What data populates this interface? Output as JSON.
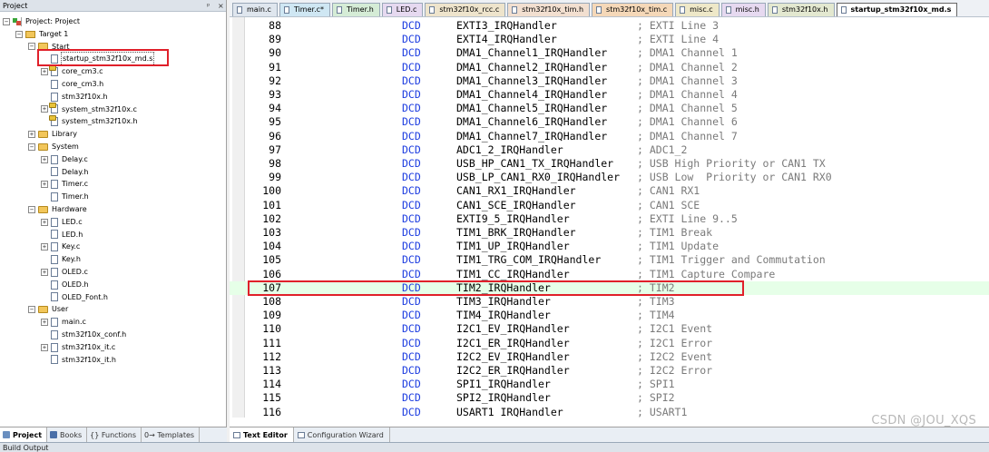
{
  "project_pane": {
    "title": "Project",
    "pin_glyph": "ᵖ",
    "close_glyph": "×",
    "tree": [
      {
        "id": "root",
        "label": "Project: Project",
        "icon": "project-icon",
        "toggle": "−",
        "level": 0
      },
      {
        "id": "target1",
        "label": "Target 1",
        "icon": "target-icon",
        "toggle": "−",
        "level": 1
      },
      {
        "id": "start",
        "label": "Start",
        "icon": "folder-icon",
        "toggle": "−",
        "level": 2
      },
      {
        "id": "startup",
        "label": "startup_stm32f10x_md.s",
        "icon": "file-icon",
        "toggle": "",
        "level": 3,
        "selected": true
      },
      {
        "id": "core_cm3_c",
        "label": "core_cm3.c",
        "icon": "c-file-icon",
        "toggle": "+",
        "level": 3
      },
      {
        "id": "core_cm3_h",
        "label": "core_cm3.h",
        "icon": "file-icon",
        "toggle": "",
        "level": 3
      },
      {
        "id": "stm32f10x_h",
        "label": "stm32f10x.h",
        "icon": "file-icon",
        "toggle": "",
        "level": 3
      },
      {
        "id": "system_c",
        "label": "system_stm32f10x.c",
        "icon": "c-file-icon",
        "toggle": "+",
        "level": 3
      },
      {
        "id": "system_h",
        "label": "system_stm32f10x.h",
        "icon": "c-file-icon",
        "toggle": "",
        "level": 3
      },
      {
        "id": "library",
        "label": "Library",
        "icon": "folder-icon",
        "toggle": "+",
        "level": 2
      },
      {
        "id": "system",
        "label": "System",
        "icon": "folder-icon",
        "toggle": "−",
        "level": 2
      },
      {
        "id": "delay_c",
        "label": "Delay.c",
        "icon": "file-icon",
        "toggle": "+",
        "level": 3
      },
      {
        "id": "delay_h",
        "label": "Delay.h",
        "icon": "file-icon",
        "toggle": "",
        "level": 3
      },
      {
        "id": "timer_c",
        "label": "Timer.c",
        "icon": "file-icon",
        "toggle": "+",
        "level": 3
      },
      {
        "id": "timer_h",
        "label": "Timer.h",
        "icon": "file-icon",
        "toggle": "",
        "level": 3
      },
      {
        "id": "hardware",
        "label": "Hardware",
        "icon": "folder-icon",
        "toggle": "−",
        "level": 2
      },
      {
        "id": "led_c",
        "label": "LED.c",
        "icon": "file-icon",
        "toggle": "+",
        "level": 3
      },
      {
        "id": "led_h",
        "label": "LED.h",
        "icon": "file-icon",
        "toggle": "",
        "level": 3
      },
      {
        "id": "key_c",
        "label": "Key.c",
        "icon": "file-icon",
        "toggle": "+",
        "level": 3
      },
      {
        "id": "key_h",
        "label": "Key.h",
        "icon": "file-icon",
        "toggle": "",
        "level": 3
      },
      {
        "id": "oled_c",
        "label": "OLED.c",
        "icon": "file-icon",
        "toggle": "+",
        "level": 3
      },
      {
        "id": "oled_h",
        "label": "OLED.h",
        "icon": "file-icon",
        "toggle": "",
        "level": 3
      },
      {
        "id": "oled_font_h",
        "label": "OLED_Font.h",
        "icon": "file-icon",
        "toggle": "",
        "level": 3
      },
      {
        "id": "user",
        "label": "User",
        "icon": "folder-icon",
        "toggle": "−",
        "level": 2
      },
      {
        "id": "main_c",
        "label": "main.c",
        "icon": "file-icon",
        "toggle": "+",
        "level": 3
      },
      {
        "id": "conf_h",
        "label": "stm32f10x_conf.h",
        "icon": "file-icon",
        "toggle": "",
        "level": 3
      },
      {
        "id": "it_c",
        "label": "stm32f10x_it.c",
        "icon": "file-icon",
        "toggle": "+",
        "level": 3
      },
      {
        "id": "it_h",
        "label": "stm32f10x_it.h",
        "icon": "file-icon",
        "toggle": "",
        "level": 3
      }
    ],
    "bottom_tabs": [
      "Project",
      "Books",
      "{} Functions",
      "0→ Templates"
    ]
  },
  "editor": {
    "tabs": [
      {
        "label": "main.c",
        "color": "#dfe6ee"
      },
      {
        "label": "Timer.c*",
        "color": "#cfe7f3"
      },
      {
        "label": "Timer.h",
        "color": "#d5ecd6"
      },
      {
        "label": "LED.c",
        "color": "#e6d9f0"
      },
      {
        "label": "stm32f10x_rcc.c",
        "color": "#eee4cc"
      },
      {
        "label": "stm32f10x_tim.h",
        "color": "#f2dfd0"
      },
      {
        "label": "stm32f10x_tim.c",
        "color": "#f5d8b8"
      },
      {
        "label": "misc.c",
        "color": "#eee8c8"
      },
      {
        "label": "misc.h",
        "color": "#e6d9f0"
      },
      {
        "label": "stm32f10x.h",
        "color": "#e3e8d0"
      },
      {
        "label": "startup_stm32f10x_md.s",
        "color": "#ffffff",
        "active": true
      }
    ],
    "lines": [
      {
        "num": "88",
        "kw": "DCD",
        "sym": "EXTI3_IRQHandler",
        "cm": "; EXTI Line 3"
      },
      {
        "num": "89",
        "kw": "DCD",
        "sym": "EXTI4_IRQHandler",
        "cm": "; EXTI Line 4"
      },
      {
        "num": "90",
        "kw": "DCD",
        "sym": "DMA1_Channel1_IRQHandler",
        "cm": "; DMA1 Channel 1"
      },
      {
        "num": "91",
        "kw": "DCD",
        "sym": "DMA1_Channel2_IRQHandler",
        "cm": "; DMA1 Channel 2"
      },
      {
        "num": "92",
        "kw": "DCD",
        "sym": "DMA1_Channel3_IRQHandler",
        "cm": "; DMA1 Channel 3"
      },
      {
        "num": "93",
        "kw": "DCD",
        "sym": "DMA1_Channel4_IRQHandler",
        "cm": "; DMA1 Channel 4"
      },
      {
        "num": "94",
        "kw": "DCD",
        "sym": "DMA1_Channel5_IRQHandler",
        "cm": "; DMA1 Channel 5"
      },
      {
        "num": "95",
        "kw": "DCD",
        "sym": "DMA1_Channel6_IRQHandler",
        "cm": "; DMA1 Channel 6"
      },
      {
        "num": "96",
        "kw": "DCD",
        "sym": "DMA1_Channel7_IRQHandler",
        "cm": "; DMA1 Channel 7"
      },
      {
        "num": "97",
        "kw": "DCD",
        "sym": "ADC1_2_IRQHandler",
        "cm": "; ADC1_2"
      },
      {
        "num": "98",
        "kw": "DCD",
        "sym": "USB_HP_CAN1_TX_IRQHandler",
        "cm": "; USB High Priority or CAN1 TX"
      },
      {
        "num": "99",
        "kw": "DCD",
        "sym": "USB_LP_CAN1_RX0_IRQHandler",
        "cm": "; USB Low  Priority or CAN1 RX0"
      },
      {
        "num": "100",
        "kw": "DCD",
        "sym": "CAN1_RX1_IRQHandler",
        "cm": "; CAN1 RX1"
      },
      {
        "num": "101",
        "kw": "DCD",
        "sym": "CAN1_SCE_IRQHandler",
        "cm": "; CAN1 SCE"
      },
      {
        "num": "102",
        "kw": "DCD",
        "sym": "EXTI9_5_IRQHandler",
        "cm": "; EXTI Line 9..5"
      },
      {
        "num": "103",
        "kw": "DCD",
        "sym": "TIM1_BRK_IRQHandler",
        "cm": "; TIM1 Break"
      },
      {
        "num": "104",
        "kw": "DCD",
        "sym": "TIM1_UP_IRQHandler",
        "cm": "; TIM1 Update"
      },
      {
        "num": "105",
        "kw": "DCD",
        "sym": "TIM1_TRG_COM_IRQHandler",
        "cm": "; TIM1 Trigger and Commutation"
      },
      {
        "num": "106",
        "kw": "DCD",
        "sym": "TIM1_CC_IRQHandler",
        "cm": "; TIM1 Capture Compare"
      },
      {
        "num": "107",
        "kw": "DCD",
        "sym": "TIM2_IRQHandler",
        "cm": "; TIM2",
        "current": true
      },
      {
        "num": "108",
        "kw": "DCD",
        "sym": "TIM3_IRQHandler",
        "cm": "; TIM3"
      },
      {
        "num": "109",
        "kw": "DCD",
        "sym": "TIM4_IRQHandler",
        "cm": "; TIM4"
      },
      {
        "num": "110",
        "kw": "DCD",
        "sym": "I2C1_EV_IRQHandler",
        "cm": "; I2C1 Event"
      },
      {
        "num": "111",
        "kw": "DCD",
        "sym": "I2C1_ER_IRQHandler",
        "cm": "; I2C1 Error"
      },
      {
        "num": "112",
        "kw": "DCD",
        "sym": "I2C2_EV_IRQHandler",
        "cm": "; I2C2 Event"
      },
      {
        "num": "113",
        "kw": "DCD",
        "sym": "I2C2_ER_IRQHandler",
        "cm": "; I2C2 Error"
      },
      {
        "num": "114",
        "kw": "DCD",
        "sym": "SPI1_IRQHandler",
        "cm": "; SPI1"
      },
      {
        "num": "115",
        "kw": "DCD",
        "sym": "SPI2_IRQHandler",
        "cm": "; SPI2"
      },
      {
        "num": "116",
        "kw": "DCD",
        "sym": "USART1_IRQHandler",
        "cm": "; USART1"
      }
    ],
    "bottom_tabs": [
      "Text Editor",
      "Configuration Wizard"
    ]
  },
  "build_output_label": "Build Output",
  "watermark": "CSDN @JOU_XQS",
  "colors": {
    "highlight_box": "#e0202a",
    "keyword": "#1c3ce0",
    "comment": "#7a7a7a",
    "current_line": "#e6ffe8"
  }
}
